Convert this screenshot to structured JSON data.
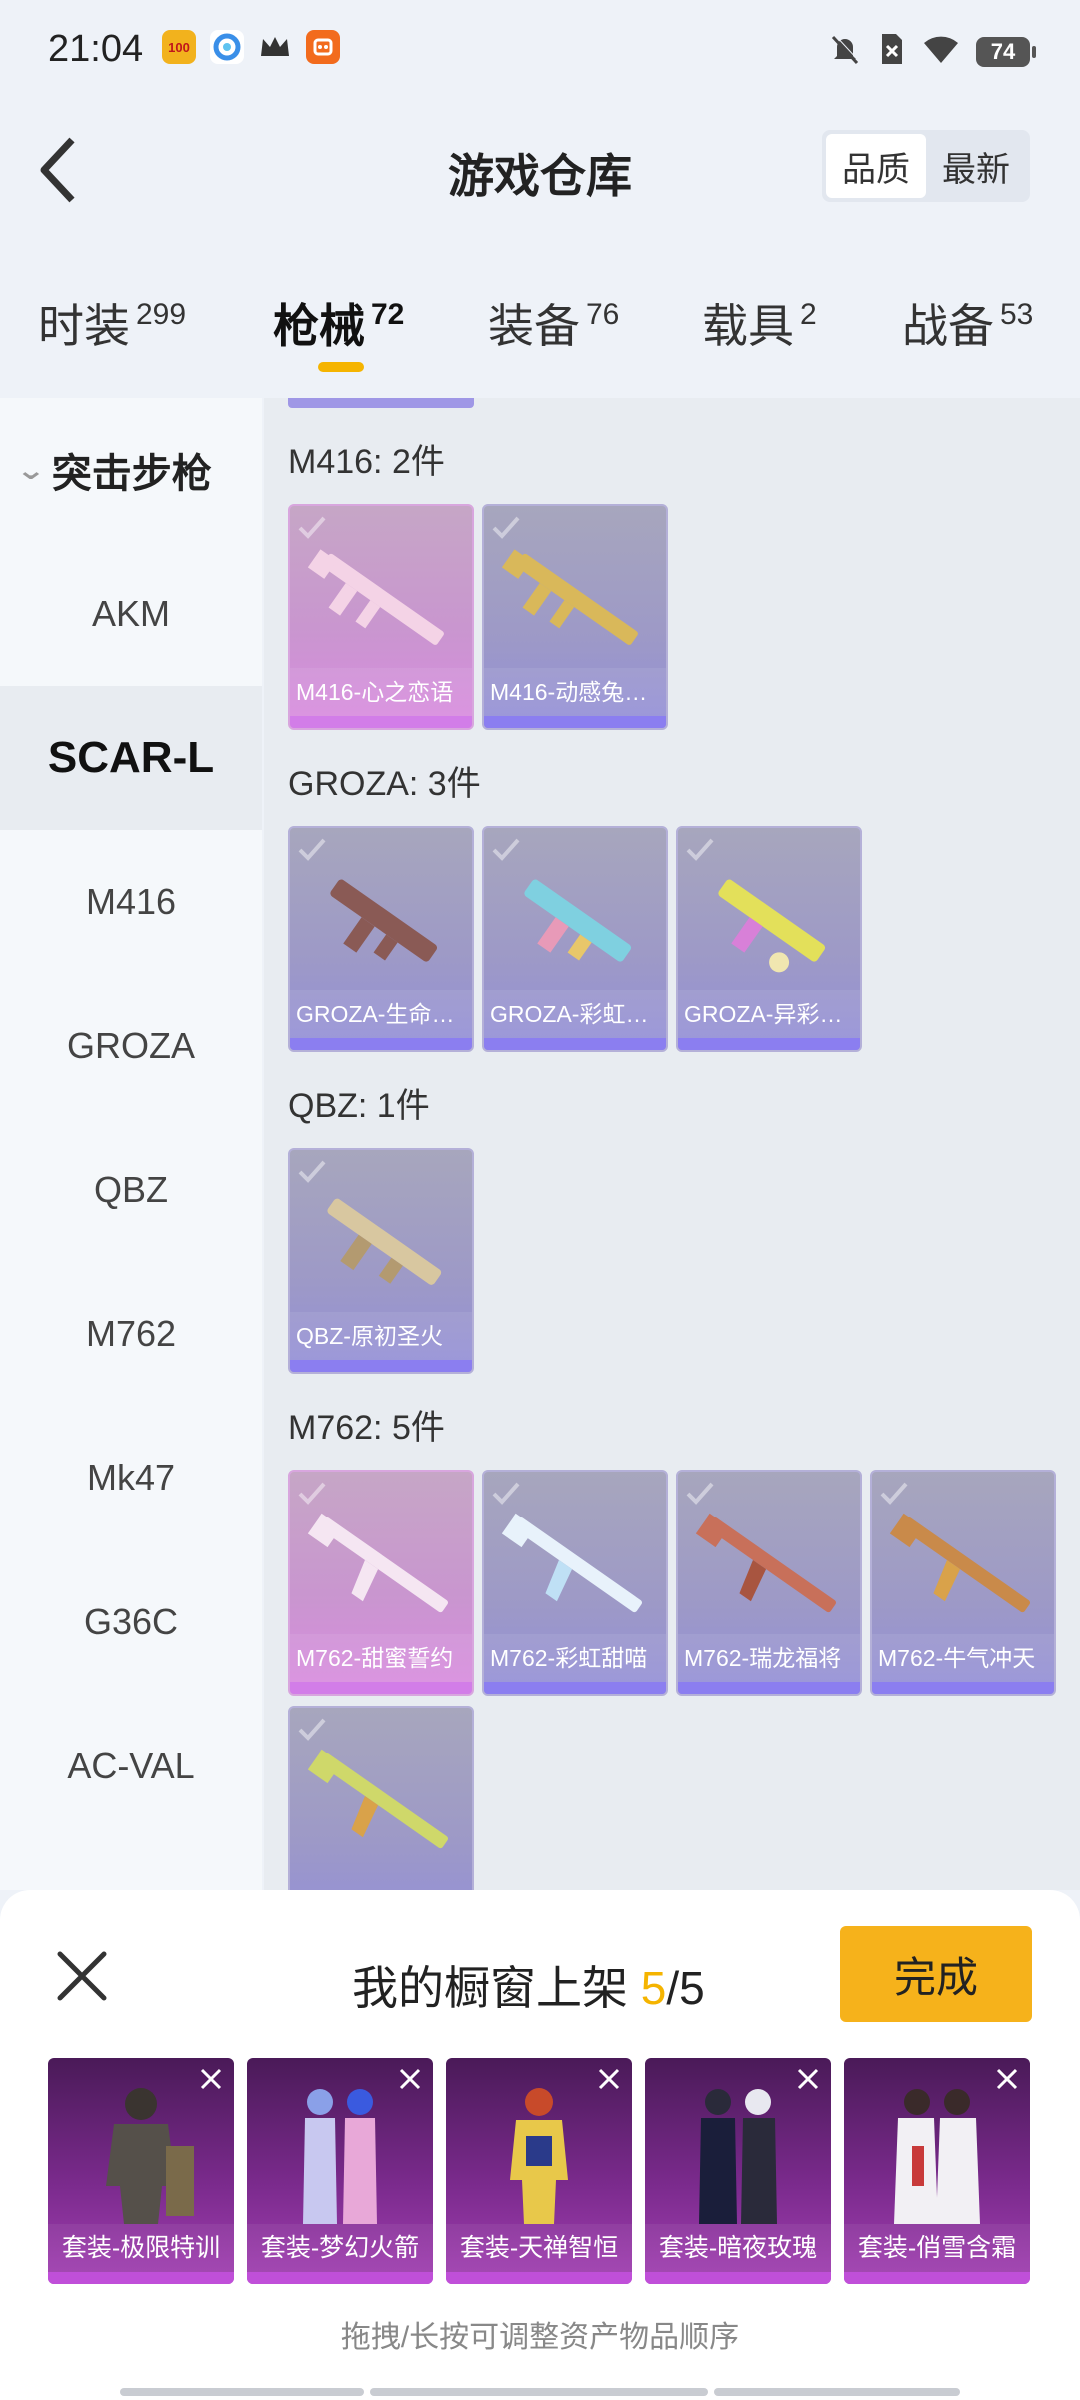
{
  "status_bar": {
    "time": "21:04",
    "battery": "74",
    "app_icons": [
      {
        "name": "app-100-icon",
        "label": "100",
        "color": "#f2b21d"
      },
      {
        "name": "app-blue-icon",
        "label": "",
        "color": "#3a8fe8"
      },
      {
        "name": "crown-icon",
        "label": "",
        "color": "#333333"
      },
      {
        "name": "app-orange-icon",
        "label": "",
        "color": "#f26b1d"
      }
    ]
  },
  "header": {
    "title": "游戏仓库",
    "sort_options": [
      "品质",
      "最新"
    ]
  },
  "category_tabs": [
    {
      "label": "时装",
      "count": "299"
    },
    {
      "label": "枪械",
      "count": "72"
    },
    {
      "label": "装备",
      "count": "76"
    },
    {
      "label": "载具",
      "count": "2"
    },
    {
      "label": "战备",
      "count": "53"
    }
  ],
  "sidebar": {
    "group": "突击步枪",
    "items": [
      "AKM",
      "SCAR-L",
      "M416",
      "GROZA",
      "QBZ",
      "M762",
      "Mk47",
      "G36C",
      "AC-VAL"
    ]
  },
  "sections": [
    {
      "title": "M416: 2件",
      "items": [
        {
          "label": "M416-心之恋语",
          "rarity": "pink"
        },
        {
          "label": "M416-动感兔…",
          "rarity": "purple"
        }
      ]
    },
    {
      "title": "GROZA: 3件",
      "items": [
        {
          "label": "GROZA-生命…",
          "rarity": "purple"
        },
        {
          "label": "GROZA-彩虹…",
          "rarity": "purple"
        },
        {
          "label": "GROZA-异彩…",
          "rarity": "purple"
        }
      ]
    },
    {
      "title": "QBZ: 1件",
      "items": [
        {
          "label": "QBZ-原初圣火",
          "rarity": "purple"
        }
      ]
    },
    {
      "title": "M762: 5件",
      "items": [
        {
          "label": "M762-甜蜜誓约",
          "rarity": "pink"
        },
        {
          "label": "M762-彩虹甜喵",
          "rarity": "purple"
        },
        {
          "label": "M762-瑞龙福将",
          "rarity": "purple"
        },
        {
          "label": "M762-牛气冲天",
          "rarity": "purple"
        }
      ]
    }
  ],
  "showcase": {
    "title_prefix": "我的橱窗上架 ",
    "count": "5",
    "total": "/5",
    "done_label": "完成",
    "hint": "拖拽/长按可调整资产物品顺序",
    "items": [
      "套装-极限特训",
      "套装-梦幻火箭",
      "套装-天禅智恒",
      "套装-暗夜玫瑰",
      "套装-俏雪含霜"
    ]
  },
  "colors": {
    "accent": "#f5b400",
    "done_button": "#f6b21b",
    "purple_card": "#9d99c7",
    "pink_card": "#c996cf",
    "suit_card": "#7a2a8c"
  }
}
